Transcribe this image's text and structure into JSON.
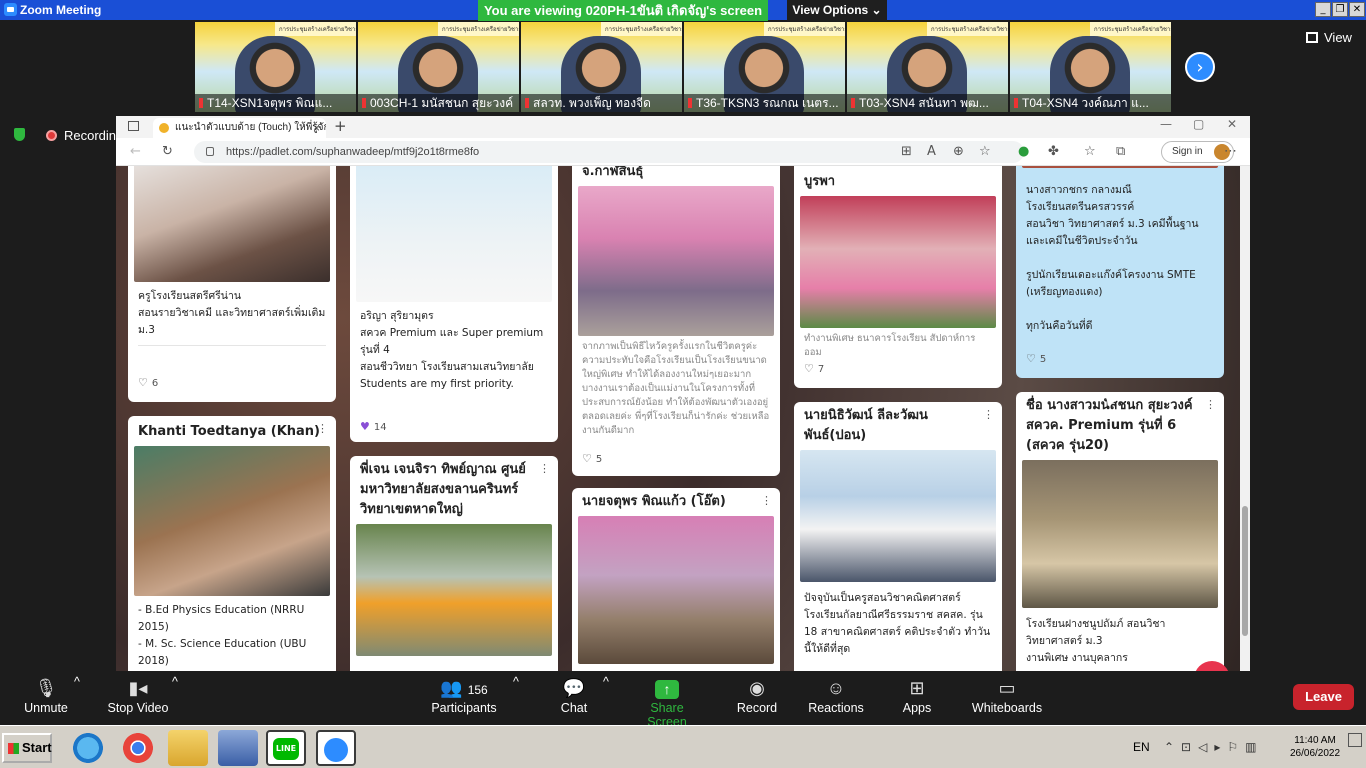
{
  "window": {
    "title": "Zoom Meeting",
    "controls": [
      "_",
      "❐",
      "✕"
    ]
  },
  "banner": {
    "viewing": "You are viewing 020PH-1ขันติ เกิดจัญ's screen",
    "view_options": "View Options ⌄"
  },
  "thumbnails": [
    {
      "name": "T14-XSN1จตุพร พิณแ..."
    },
    {
      "name": "003CH-1 มนัสชนก สุยะวงค์"
    },
    {
      "name": "สลวท. พวงเพ็ญ  ทองจีด"
    },
    {
      "name": "T36-TKSN3 รณกณ เนตร..."
    },
    {
      "name": "T03-XSN4 สนันทา พฒ..."
    },
    {
      "name": "T04-XSN4 วงค์ณภา แ..."
    }
  ],
  "thumb_header": "การประชุมสร้างเครือข่ายวิชาการ",
  "view_label": "View",
  "recording_label": "Recording",
  "browser": {
    "tab_title": "แนะนำตัวแบบด้าย (Touch) ให้พี่รู้จัก",
    "new_tab": "+",
    "url": "https://padlet.com/suphanwadeep/mtf9j2o1t8rme8fo",
    "signin": "Sign in"
  },
  "cards": [
    {
      "col": 1,
      "title": "",
      "text": "ครูโรงเรียนสตรีศรีน่าน\nสอนรายวิชาเคมี และวิทยาศาสตร์เพิ่มเติม ม.3",
      "likes": "6"
    },
    {
      "col": 1,
      "title": "Khanti Toedtanya (Khan)",
      "text": "- B.Ed Physics Education (NRRU 2015)\n- M. Sc. Science Education (UBU 2018)",
      "likes": ""
    },
    {
      "col": 2,
      "title": "",
      "text": "อริญา สุริยามุตร\nสควค Premium  และ Super premium รุ่นที่ 4\nสอนชีววิทยา โรงเรียนสามเสนวิทยาลัย\nStudents are my first priority.",
      "likes": "14"
    },
    {
      "col": 2,
      "title": "พี่เจน เจนจิรา ทิพย์ญาณ ศูนย์มหาวิทยาลัยสงขลานครินทร์ วิทยาเขตหาดใหญ่",
      "text": "",
      "likes": ""
    },
    {
      "col": 3,
      "title": "จ.กาฬสินธุ์",
      "text": "จากภาพเป็นพิธีไหว้ครูครั้งแรกในชีวิตครูค่ะ ความประทับใจคือโรงเรียนเป็นโรงเรียนขนาดใหญ่พิเศษ ทำให้ได้ลองงานใหม่ๆเยอะมาก บางงานเราต้องเป็นแม่งานในโครงการทั้งที่ประสบการณ์ยังน้อย ทำให้ต้องพัฒนาตัวเองอยู่ตลอดเลยค่ะ พี่ๆที่โรงเรียนก็น่ารักค่ะ ช่วยเหลืองานกันดีมาก",
      "likes": "5"
    },
    {
      "col": 3,
      "title": "นายจตุพร พิณแก้ว (โอ๊ต)",
      "text": "",
      "likes": ""
    },
    {
      "col": 4,
      "title": "บูรพา",
      "text": "ทำงานพิเศษ ธนาคารโรงเรียน สัปดาห์การออม",
      "likes": "7"
    },
    {
      "col": 4,
      "title": "นายนิธิวัฒน์ ลีละวัฒน พันธ์(ปอน)",
      "text": "ปัจจุบันเป็นครูสอนวิชาคณิตศาสตร์ โรงเรียนกัลยาณีศรีธรรมราช สคสค. รุ่น 18 สาขาคณิตศาสตร์ คติประจำตัว ทำวันนี้ให้ดีที่สุด",
      "likes": ""
    },
    {
      "col": 5,
      "title": "",
      "text": "นางสาวกชกร กลางมณี\nโรงเรียนสตรีนครสวรรค์\nสอนวิชา วิทยาศาสตร์ ม.3 เคมีพื้นฐาน และเคมีในชีวิตประจำวัน\n\nรูปนักเรียนเดอะแก๊งค์โครงงาน SMTE (เหรียญทองแดง)\n\nทุกวันคือวันที่ดี",
      "likes": "5"
    },
    {
      "col": 5,
      "title": "ชื่อ นางสาวมนัสชนก สุยะวงค์ สควค. Premium รุ่นที่ 6 (สควค รุ่น20)",
      "text": "โรงเรียนฝางชนูปถัมภ์ สอนวิชาวิทยาศาสตร์ ม.3\nงานพิเศษ งานบุคลากร",
      "likes": ""
    }
  ],
  "toolbar": {
    "unmute": "Unmute",
    "stop_video": "Stop Video",
    "participants": "Participants",
    "participants_count": "156",
    "chat": "Chat",
    "share": "Share Screen",
    "record": "Record",
    "reactions": "Reactions",
    "apps": "Apps",
    "whiteboards": "Whiteboards",
    "leave": "Leave"
  },
  "taskbar": {
    "start": "Start",
    "lang": "EN",
    "time": "11:40 AM",
    "date": "26/06/2022"
  },
  "colors": {
    "zoom_blue": "#2d8cff",
    "share_green": "#2fb83f",
    "leave_red": "#c8232c",
    "titlebar": "#1a4fd6"
  }
}
